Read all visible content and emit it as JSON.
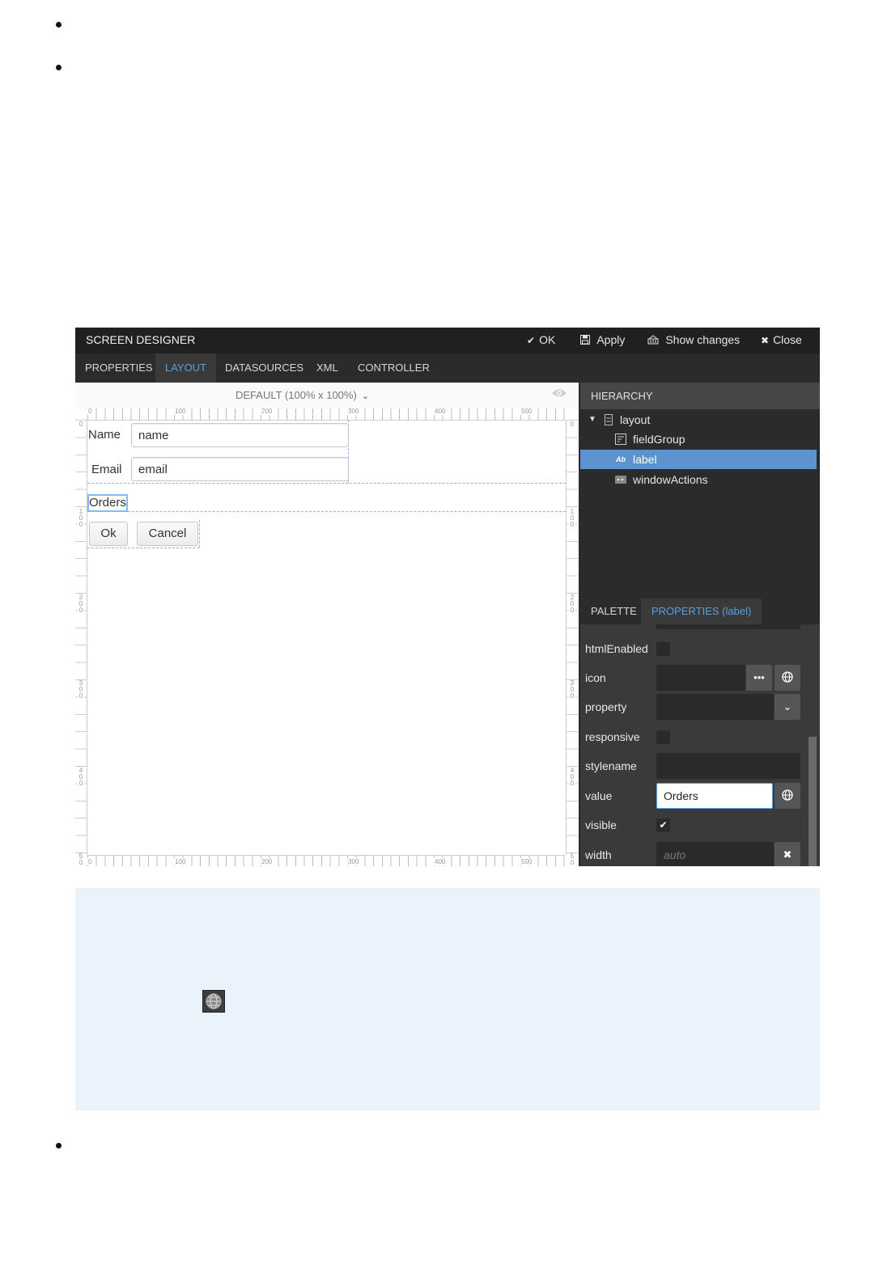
{
  "designer": {
    "title": "SCREEN DESIGNER",
    "actions": [
      {
        "icon": "check-icon",
        "label": "OK"
      },
      {
        "icon": "save-icon",
        "label": "Apply"
      },
      {
        "icon": "show-changes-icon",
        "label": "Show changes"
      },
      {
        "icon": "close-icon",
        "label": "Close"
      }
    ],
    "tabs": [
      "PROPERTIES",
      "LAYOUT",
      "DATASOURCES",
      "XML",
      "CONTROLLER"
    ],
    "active_tab": "LAYOUT"
  },
  "canvas": {
    "profile": "DEFAULT (100% x 100%)",
    "ruler_labels": [
      "0",
      "100",
      "200",
      "300",
      "400",
      "500"
    ],
    "vertical_ruler_labels": [
      "0",
      "100",
      "200",
      "300",
      "400",
      "500"
    ],
    "form": {
      "name_label": "Name",
      "name_value": "name",
      "email_label": "Email",
      "email_value": "email",
      "orders_label": "Orders",
      "ok_button": "Ok",
      "cancel_button": "Cancel"
    }
  },
  "hierarchy": {
    "title": "HIERARCHY",
    "nodes": [
      {
        "label": "layout",
        "icon": "layout-icon"
      },
      {
        "label": "fieldGroup",
        "icon": "field-group-icon"
      },
      {
        "label": "label",
        "icon": "label-icon"
      },
      {
        "label": "windowActions",
        "icon": "window-actions-icon"
      }
    ],
    "selected": "label"
  },
  "bottom_tabs": [
    "PALETTE",
    "PROPERTIES (label)"
  ],
  "active_bottom_tab": "PROPERTIES (label)",
  "properties": {
    "htmlEnabled": {
      "label": "htmlEnabled",
      "checked": false
    },
    "icon": {
      "label": "icon",
      "value": ""
    },
    "property": {
      "label": "property",
      "value": ""
    },
    "responsive": {
      "label": "responsive",
      "checked": false
    },
    "stylename": {
      "label": "stylename",
      "value": ""
    },
    "value": {
      "label": "value",
      "value": "Orders"
    },
    "visible": {
      "label": "visible",
      "checked": true
    },
    "width": {
      "label": "width",
      "placeholder": "auto"
    }
  },
  "colors": {
    "accent": "#5a9fe0",
    "selection": "#5c93cf",
    "dark_bg": "#2b2b2b",
    "info_bg": "#eaf2fc"
  }
}
